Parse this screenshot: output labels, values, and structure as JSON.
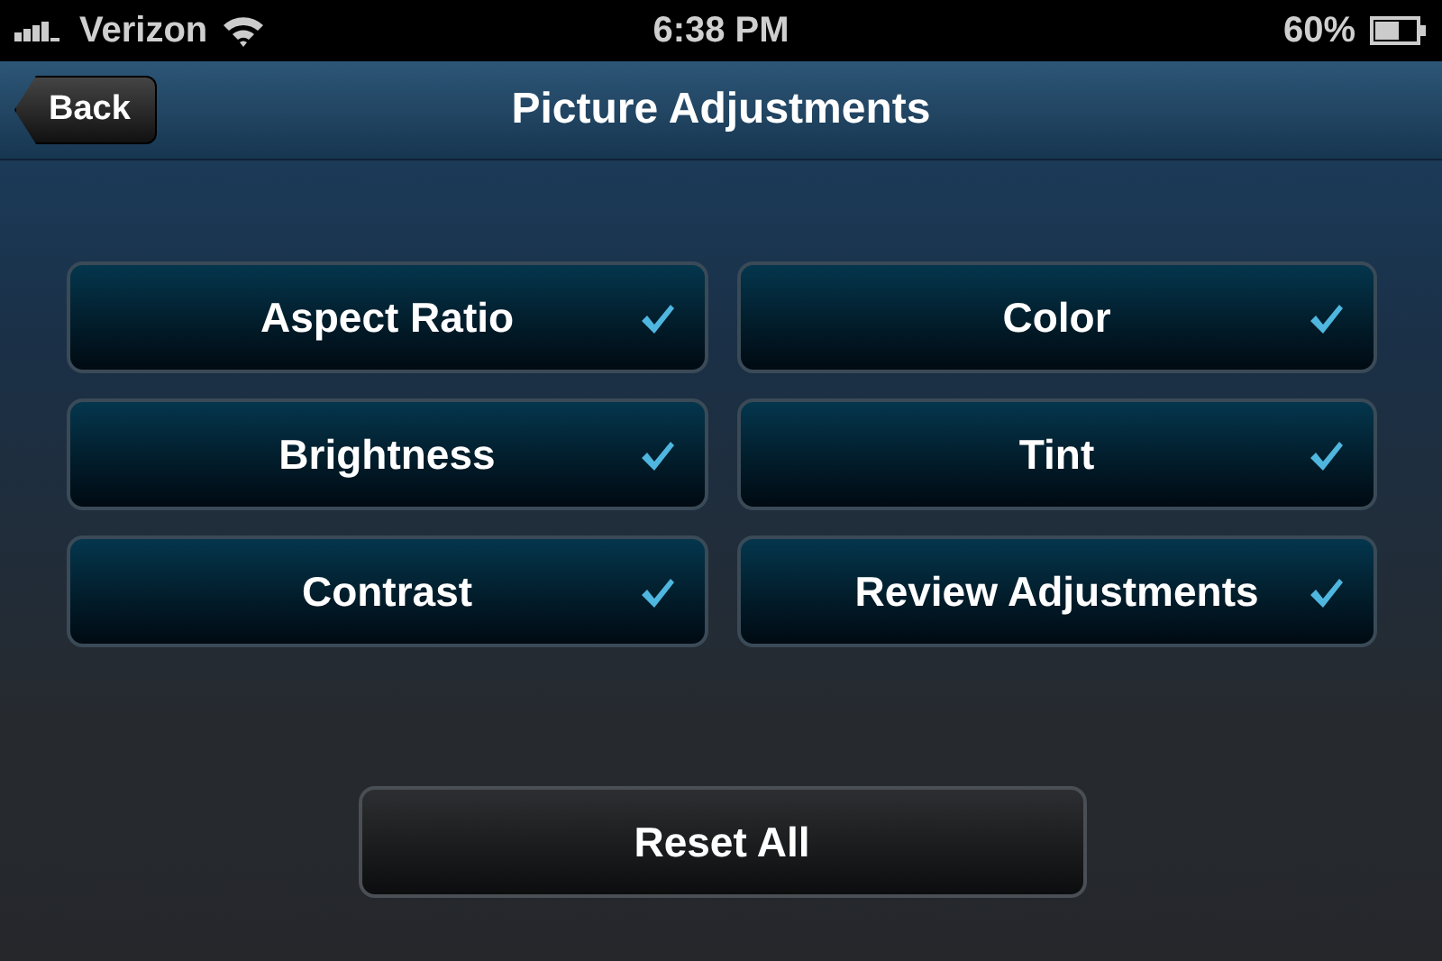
{
  "status_bar": {
    "carrier": "Verizon",
    "time": "6:38 PM",
    "battery": "60%"
  },
  "nav": {
    "back": "Back",
    "title": "Picture Adjustments"
  },
  "options": [
    {
      "label": "Aspect Ratio",
      "checked": true
    },
    {
      "label": "Color",
      "checked": true
    },
    {
      "label": "Brightness",
      "checked": true
    },
    {
      "label": "Tint",
      "checked": true
    },
    {
      "label": "Contrast",
      "checked": true
    },
    {
      "label": "Review Adjustments",
      "checked": true
    }
  ],
  "reset": "Reset All"
}
